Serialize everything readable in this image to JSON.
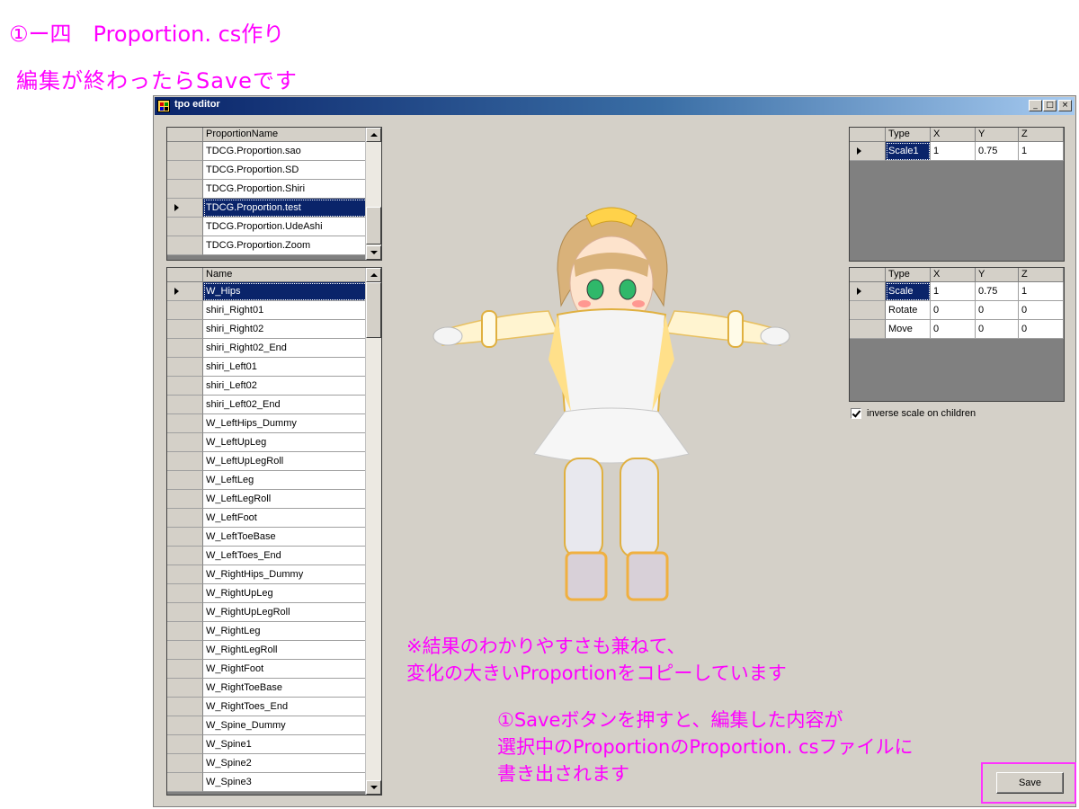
{
  "annotations": {
    "title": "①ー四　Proportion. cs作り",
    "subtitle": "編集が終わったらSaveです",
    "result_note_line1": "※結果のわかりやすさも兼ねて、",
    "result_note_line2": "変化の大きいProportionをコピーしています",
    "save_note_line1": "①Saveボタンを押すと、編集した内容が",
    "save_note_line2": "選択中のProportionのProportion. csファイルに",
    "save_note_line3": "書き出されます"
  },
  "window": {
    "title": "tpo editor",
    "controls": {
      "minimize": "_",
      "maximize": "□",
      "close": "×"
    }
  },
  "proportion_grid": {
    "header": "ProportionName",
    "rows": [
      "TDCG.Proportion.sao",
      "TDCG.Proportion.SD",
      "TDCG.Proportion.Shiri",
      "TDCG.Proportion.test",
      "TDCG.Proportion.UdeAshi",
      "TDCG.Proportion.Zoom"
    ],
    "selected_index": 3
  },
  "node_grid": {
    "header": "Name",
    "rows": [
      "W_Hips",
      "shiri_Right01",
      "shiri_Right02",
      "shiri_Right02_End",
      "shiri_Left01",
      "shiri_Left02",
      "shiri_Left02_End",
      "W_LeftHips_Dummy",
      "W_LeftUpLeg",
      "W_LeftUpLegRoll",
      "W_LeftLeg",
      "W_LeftLegRoll",
      "W_LeftFoot",
      "W_LeftToeBase",
      "W_LeftToes_End",
      "W_RightHips_Dummy",
      "W_RightUpLeg",
      "W_RightUpLegRoll",
      "W_RightLeg",
      "W_RightLegRoll",
      "W_RightFoot",
      "W_RightToeBase",
      "W_RightToes_End",
      "W_Spine_Dummy",
      "W_Spine1",
      "W_Spine2",
      "W_Spine3"
    ],
    "selected_index": 0
  },
  "scale_grid": {
    "headers": {
      "type": "Type",
      "x": "X",
      "y": "Y",
      "z": "Z"
    },
    "row": {
      "type": "Scale1",
      "x": "1",
      "y": "0.75",
      "z": "1"
    }
  },
  "transform_grid": {
    "headers": {
      "type": "Type",
      "x": "X",
      "y": "Y",
      "z": "Z"
    },
    "rows": [
      {
        "type": "Scale",
        "x": "1",
        "y": "0.75",
        "z": "1"
      },
      {
        "type": "Rotate",
        "x": "0",
        "y": "0",
        "z": "0"
      },
      {
        "type": "Move",
        "x": "0",
        "y": "0",
        "z": "0"
      }
    ]
  },
  "inverse_scale_checkbox": {
    "label": "inverse scale on children",
    "checked": true
  },
  "save_button": {
    "label": "Save"
  },
  "colors": {
    "annotation": "#ff00ff",
    "selection": "#0a246a",
    "window_bg": "#d4d0c8",
    "grid_empty": "#808080",
    "highlight_box": "#ff33ff"
  }
}
